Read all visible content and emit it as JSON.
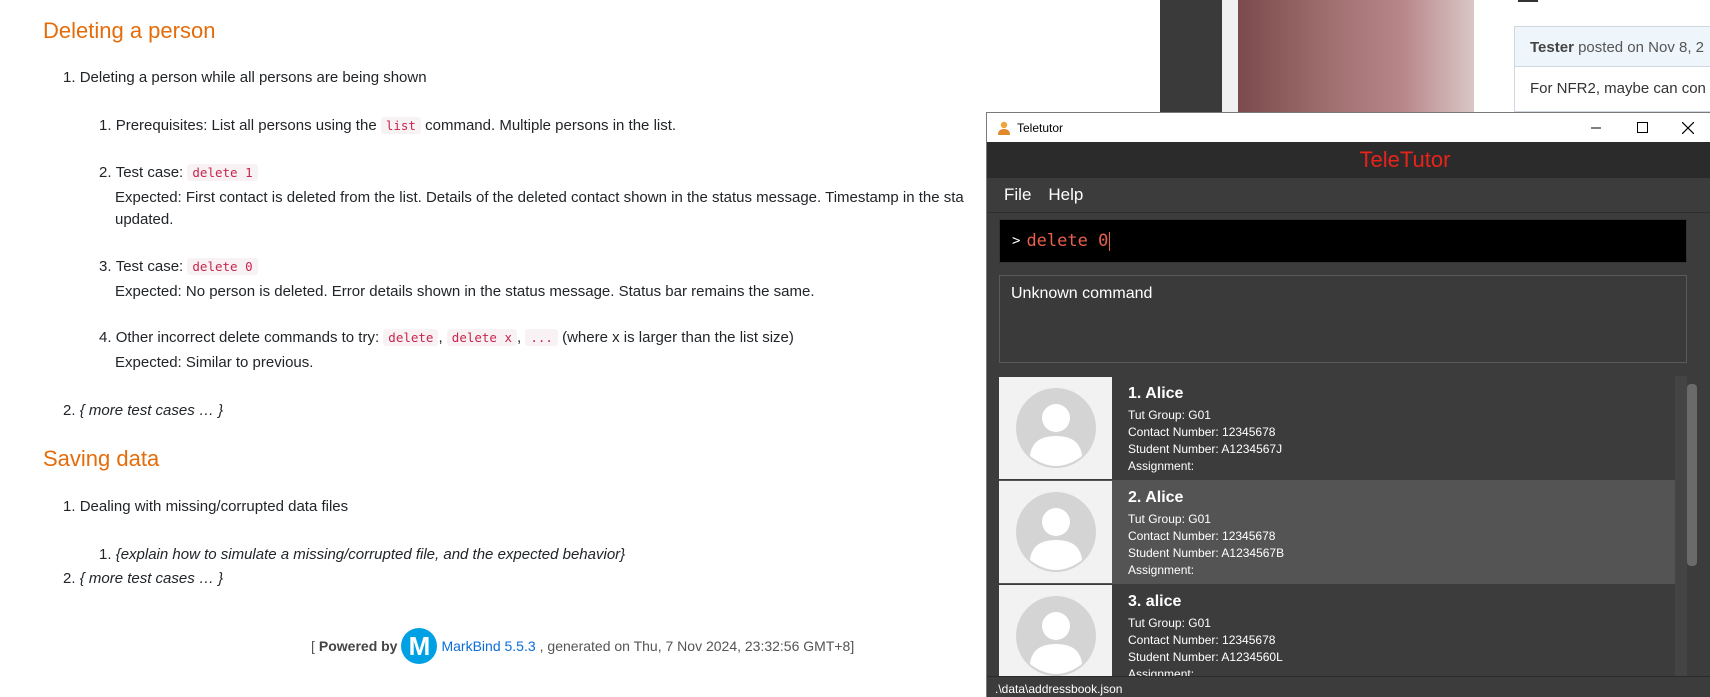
{
  "doc": {
    "section1_title": "Deleting a person",
    "item1": "Deleting a person while all persons are being shown",
    "sub1_prefix": "Prerequisites: List all persons using the",
    "sub1_code": "list",
    "sub1_suffix": "command. Multiple persons in the list.",
    "sub2_label": "Test case:",
    "sub2_code": "delete 1",
    "sub2_expected": "Expected: First contact is deleted from the list. Details of the deleted contact shown in the status message. Timestamp in the sta",
    "sub2_expected2": "updated.",
    "sub3_label": "Test case:",
    "sub3_code": "delete 0",
    "sub3_expected": "Expected: No person is deleted. Error details shown in the status message. Status bar remains the same.",
    "sub4_prefix": "Other incorrect delete commands to try:",
    "sub4_code1": "delete",
    "sub4_code2": "delete x",
    "sub4_code3": "...",
    "sub4_suffix": "(where x is larger than the list size)",
    "sub4_expected": "Expected: Similar to previous.",
    "item2": "{ more test cases … }",
    "section2_title": "Saving data",
    "save_item1": "Dealing with missing/corrupted data files",
    "save_sub1": "{explain how to simulate a missing/corrupted file, and the expected behavior}",
    "save_item2": "{ more test cases … }",
    "footer_powered": "Powered by",
    "footer_link": "MarkBind 5.5.3",
    "footer_generated": ", generated on Thu, 7 Nov 2024, 23:32:56 GMT+8]",
    "footer_open": "[",
    "logo_letter": "M"
  },
  "background": {
    "comment_author": "Tester",
    "comment_meta": "posted on Nov 8, 2",
    "comment_body": "For NFR2, maybe can con"
  },
  "teletutor": {
    "window_title": "Teletutor",
    "app_title": "TeleTutor",
    "menus": [
      "File",
      "Help"
    ],
    "command_prompt": ">",
    "command_text": "delete 0",
    "result_text": "Unknown command",
    "persons": [
      {
        "name": "1. Alice",
        "tut_group": "Tut Group: G01",
        "contact": "Contact Number: 12345678",
        "student": "Student Number: A1234567J",
        "assignment": "Assignment:"
      },
      {
        "name": "2. Alice",
        "tut_group": "Tut Group: G01",
        "contact": "Contact Number: 12345678",
        "student": "Student Number: A1234567B",
        "assignment": "Assignment:"
      },
      {
        "name": "3. alice",
        "tut_group": "Tut Group: G01",
        "contact": "Contact Number: 12345678",
        "student": "Student Number: A1234560L",
        "assignment": "Assignment:"
      }
    ],
    "status_path": ".\\data\\addressbook.json",
    "title_color": "#e8231b",
    "command_color": "#e8604c"
  }
}
